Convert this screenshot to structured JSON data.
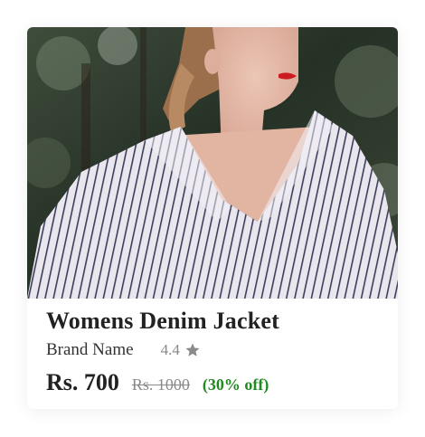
{
  "product": {
    "title": "Womens Denim Jacket",
    "brand": "Brand Name",
    "rating": "4.4",
    "price": "Rs. 700",
    "original_price": "Rs. 1000",
    "discount": "(30% off)"
  },
  "icons": {
    "rating": "star-icon"
  },
  "colors": {
    "discount": "#1f8a1f",
    "star": "#8a8a8a"
  }
}
